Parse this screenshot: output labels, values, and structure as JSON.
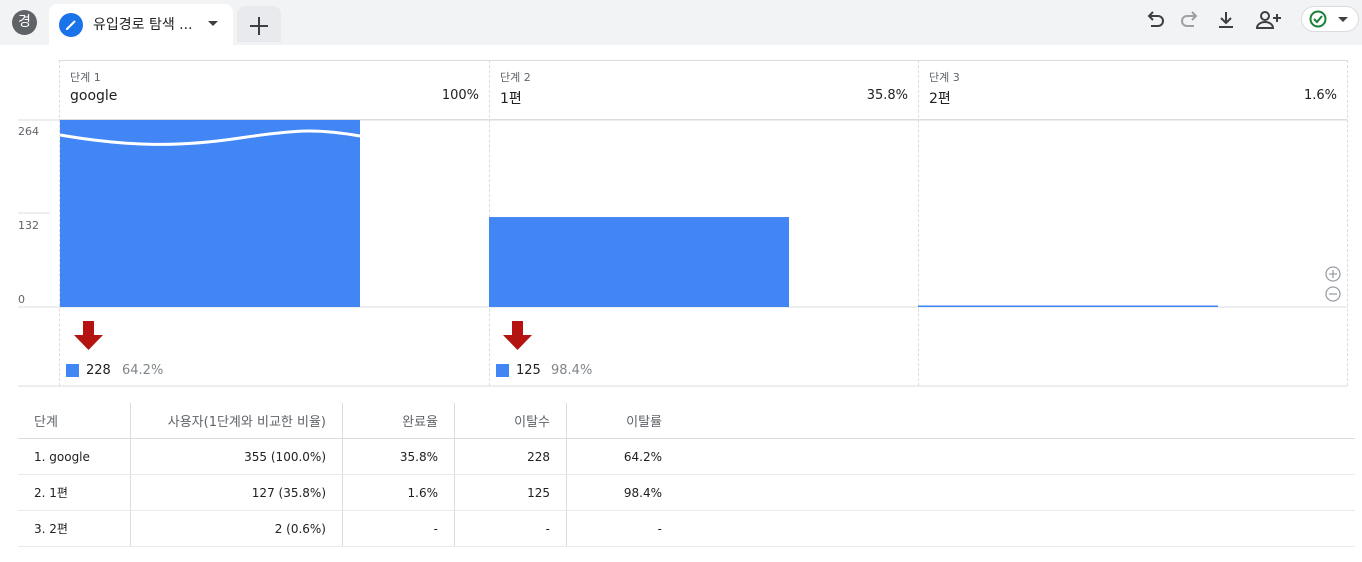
{
  "app": {
    "avatar_letter": "경"
  },
  "tab": {
    "label": "유입경로 탐색 ..."
  },
  "toolbar": {
    "undo": "undo-icon",
    "redo": "redo-icon",
    "download": "download-icon",
    "share": "person-add-icon",
    "status": "check-circle-icon"
  },
  "colors": {
    "bar": "#4285f4",
    "drop_arrow": "#b31412",
    "accent": "#1a73e8"
  },
  "funnel": {
    "steps": [
      {
        "small": "단계 1",
        "name": "google",
        "pct": "100%"
      },
      {
        "small": "단계 2",
        "name": "1편",
        "pct": "35.8%"
      },
      {
        "small": "단계 3",
        "name": "2편",
        "pct": "1.6%"
      }
    ],
    "y_ticks": [
      "264",
      "132",
      "0"
    ],
    "drops": [
      {
        "count": "228",
        "pct": "64.2%"
      },
      {
        "count": "125",
        "pct": "98.4%"
      }
    ]
  },
  "chart_data": {
    "type": "bar",
    "categories": [
      "google",
      "1편",
      "2편"
    ],
    "values": [
      355,
      127,
      2
    ],
    "ylim": [
      0,
      264
    ],
    "y_ticks": [
      0,
      132,
      264
    ],
    "grid": true,
    "note_axis_break": true
  },
  "table": {
    "headers": [
      "단계",
      "사용자(1단계와 비교한 비율)",
      "완료율",
      "이탈수",
      "이탈률"
    ],
    "rows": [
      [
        "1. google",
        "355 (100.0%)",
        "35.8%",
        "228",
        "64.2%"
      ],
      [
        "2. 1편",
        "127 (35.8%)",
        "1.6%",
        "125",
        "98.4%"
      ],
      [
        "3. 2편",
        "2 (0.6%)",
        "-",
        "-",
        "-"
      ]
    ]
  }
}
